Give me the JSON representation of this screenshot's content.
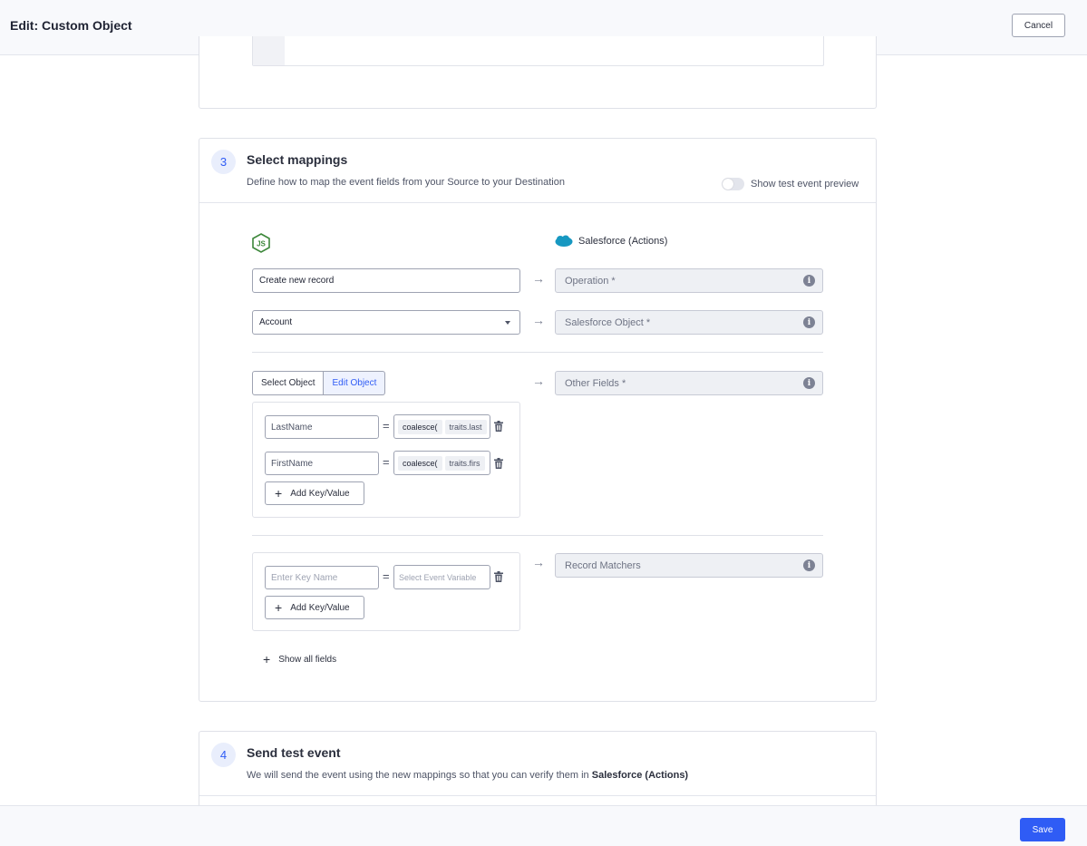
{
  "header": {
    "title": "Edit: Custom Object",
    "cancel_label": "Cancel"
  },
  "footer": {
    "save_label": "Save"
  },
  "mappings": {
    "step": "3",
    "title": "Select mappings",
    "description": "Define how to map the event fields from your Source to your Destination",
    "toggle_label": "Show test event preview",
    "destination_name": "Salesforce (Actions)",
    "operation_value": "Create new record",
    "operation_dest": "Operation *",
    "object_value": "Account",
    "object_dest": "Salesforce Object *",
    "tabs": {
      "select": "Select Object",
      "edit": "Edit Object"
    },
    "other_fields_dest": "Other Fields *",
    "pairs": [
      {
        "key": "LastName",
        "fn": "coalesce(",
        "arg": "traits.last"
      },
      {
        "key": "FirstName",
        "fn": "coalesce(",
        "arg": "traits.firs"
      }
    ],
    "add_label": "Add Key/Value",
    "matcher_key_placeholder": "Enter Key Name",
    "matcher_value_placeholder": "Select Event Variable",
    "record_matchers_dest": "Record Matchers",
    "info_glyph": "i",
    "show_all_label": "Show all fields"
  },
  "test_event": {
    "step": "4",
    "title": "Send test event",
    "description_prefix": "We will send the event using the new mappings so that you can verify them in ",
    "description_bold": "Salesforce (Actions)"
  },
  "colors": {
    "accent": "#2f5cf5",
    "border": "#9ea3b2",
    "dest_bg": "#eef0f4"
  },
  "icons": [
    "nodejs-icon",
    "salesforce-icon",
    "arrow-right-icon",
    "info-icon",
    "trash-icon",
    "plus-icon",
    "caret-down-icon"
  ]
}
